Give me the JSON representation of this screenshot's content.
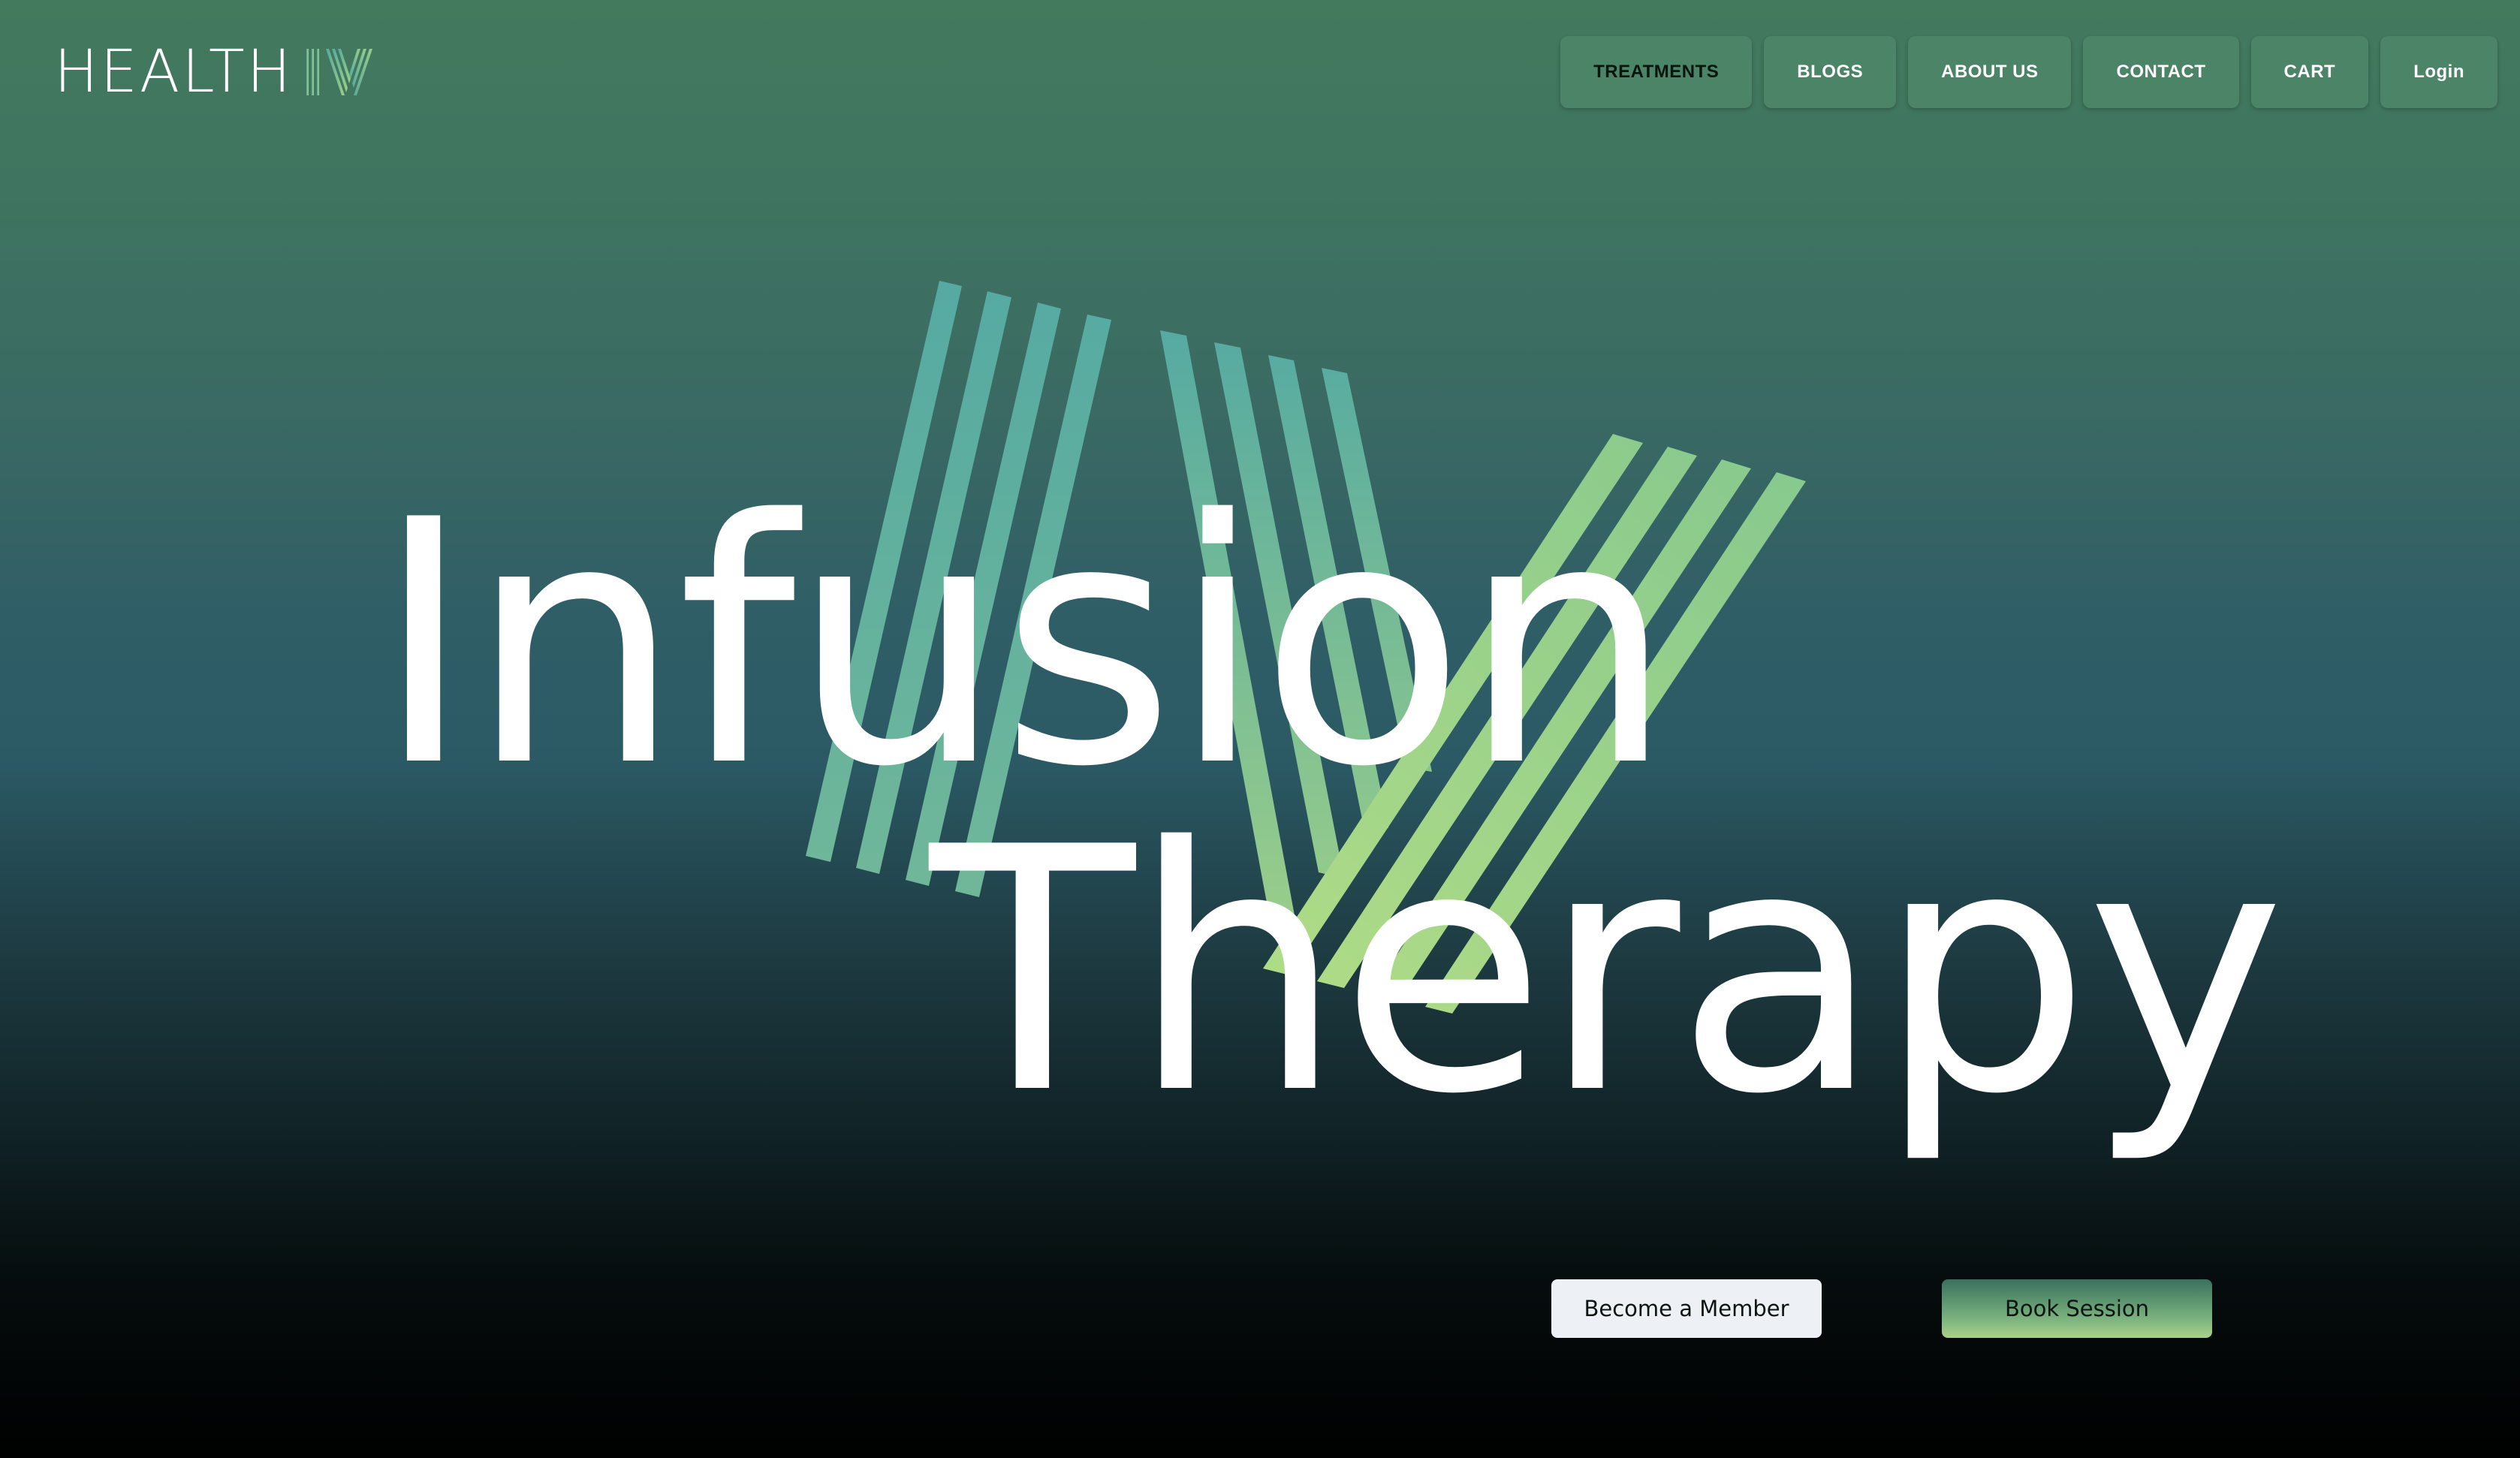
{
  "brand": {
    "name": "HEALTH",
    "logo_mark_icon": "iv-lines-logo-icon",
    "colors": [
      "#56a9a0",
      "#9ccf88"
    ]
  },
  "nav": {
    "items": [
      {
        "label": "TREATMENTS",
        "active": true
      },
      {
        "label": "BLOGS",
        "active": false
      },
      {
        "label": "ABOUT US",
        "active": false
      },
      {
        "label": "CONTACT",
        "active": false
      },
      {
        "label": "CART",
        "active": false
      },
      {
        "label": "Login",
        "active": false
      }
    ],
    "button_color": "#4b8466"
  },
  "hero": {
    "line1": "Infusion",
    "line2": "Therapy",
    "graphic_icon": "iv-striped-graphic-icon"
  },
  "cta": {
    "primary_label": "Become a Member",
    "secondary_label": "Book Session"
  },
  "colors": {
    "background_top": "#437a5e",
    "background_bottom": "#000000",
    "stripe_teal": "#56aaa1",
    "stripe_green": "#a3d586"
  }
}
